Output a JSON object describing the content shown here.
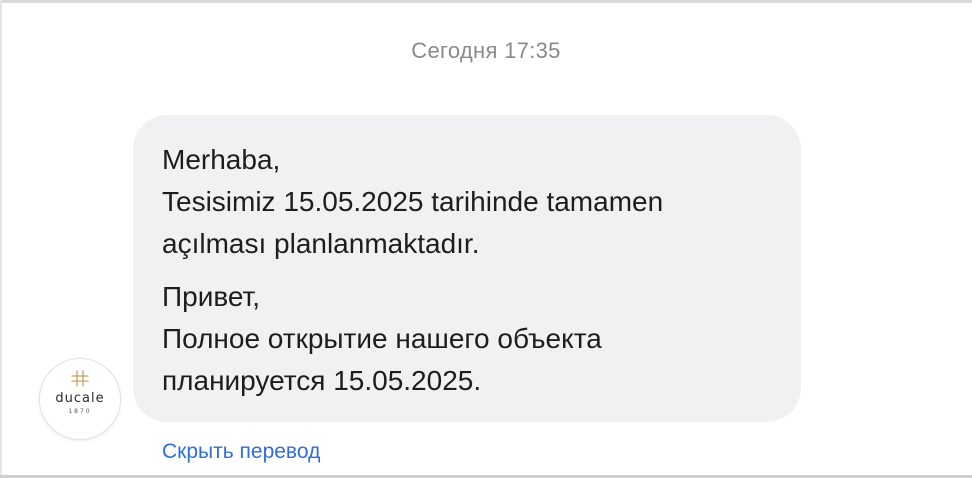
{
  "header": {
    "timestamp": "Сегодня 17:35"
  },
  "message": {
    "turkish": {
      "line1": "Merhaba,",
      "line2": "Tesisimiz 15.05.2025 tarihinde tamamen",
      "line3": "açılması planlanmaktadır."
    },
    "russian": {
      "line1": "Привет,",
      "line2": "Полное открытие нашего объекта",
      "line3": "планируется 15.05.2025."
    }
  },
  "sender": {
    "avatar_logo_text": "ducale",
    "avatar_logo_subtext": "1870",
    "avatar_icon": "ducale-logo-icon"
  },
  "actions": {
    "hide_translation": "Скрыть перевод"
  },
  "colors": {
    "bubble": "#f1f1f3",
    "link": "#2f6fd6",
    "timestamp": "#8a8a8a",
    "logo_gold": "#c7a55a"
  }
}
